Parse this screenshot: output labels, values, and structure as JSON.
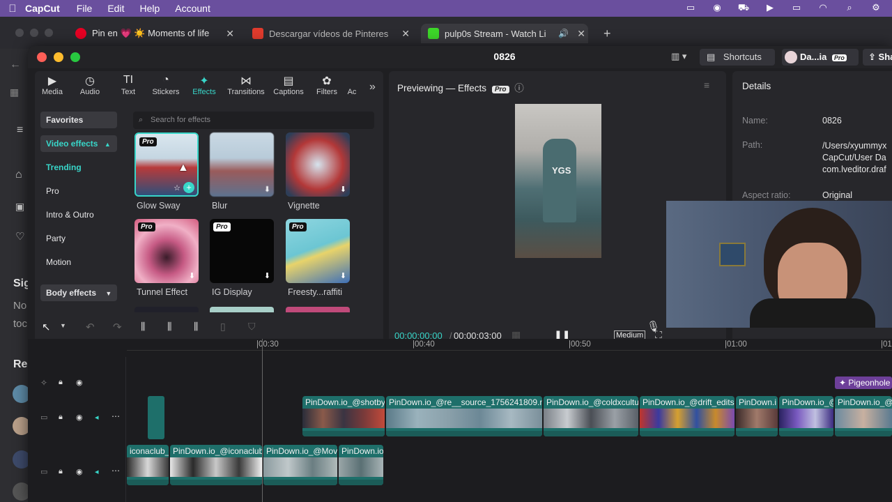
{
  "menubar": {
    "app_name": "CapCut",
    "items": [
      "File",
      "Edit",
      "Help",
      "Account"
    ]
  },
  "browser": {
    "tabs": [
      {
        "title": "Pin en 💗 ☀️ Moments of life",
        "favicon_color": "#e60023"
      },
      {
        "title": "Descargar vídeos de Pinteres",
        "favicon_color": "#e03b2d"
      },
      {
        "title": "pulp0s Stream - Watch Li",
        "favicon_color": "#3dd629"
      }
    ],
    "sidebar_text": [
      "Sig",
      "No",
      "toc",
      "Re"
    ]
  },
  "window": {
    "project_name": "0826",
    "shortcuts_label": "Shortcuts",
    "user_label": "Da...ia",
    "pro_badge": "Pro",
    "share_label": "Sha"
  },
  "tools": [
    {
      "label": "Media",
      "icon": "media-icon",
      "glyph": "▶"
    },
    {
      "label": "Audio",
      "icon": "audio-icon",
      "glyph": "◷"
    },
    {
      "label": "Text",
      "icon": "text-icon",
      "glyph": "TI"
    },
    {
      "label": "Stickers",
      "icon": "stickers-icon",
      "glyph": "◔"
    },
    {
      "label": "Effects",
      "icon": "effects-icon",
      "glyph": "✦"
    },
    {
      "label": "Transitions",
      "icon": "transitions-icon",
      "glyph": "⋈"
    },
    {
      "label": "Captions",
      "icon": "captions-icon",
      "glyph": "▤"
    },
    {
      "label": "Filters",
      "icon": "filters-icon",
      "glyph": "✿"
    },
    {
      "label": "Ac",
      "icon": "adjust-icon",
      "glyph": ""
    }
  ],
  "categories": {
    "favorites": "Favorites",
    "video_effects": "Video effects",
    "trending": "Trending",
    "pro": "Pro",
    "intro_outro": "Intro & Outro",
    "party": "Party",
    "motion": "Motion",
    "body_effects": "Body effects"
  },
  "search": {
    "placeholder": "Search for effects"
  },
  "effects": [
    {
      "name": "Glow Sway",
      "pro": true
    },
    {
      "name": "Blur",
      "pro": false
    },
    {
      "name": "Vignette",
      "pro": false
    },
    {
      "name": "Tunnel Effect",
      "pro": true
    },
    {
      "name": "IG Display",
      "pro": true
    },
    {
      "name": "Freesty...raffiti",
      "pro": true
    }
  ],
  "preview": {
    "title": "Previewing — Effects",
    "pro_badge": "Pro",
    "current_time": "00:00:00:00",
    "total_time": "00:00:03:00",
    "quality": "Medium"
  },
  "details": {
    "title": "Details",
    "name_label": "Name:",
    "name_value": "0826",
    "path_label": "Path:",
    "path_lines": [
      "/Users/xyummyx",
      "CapCut/User Da",
      "com.lveditor.draf"
    ],
    "aspect_label": "Aspect ratio:",
    "aspect_value": "Original"
  },
  "timeline": {
    "ruler": [
      "|00:30",
      "|00:40",
      "|00:50",
      "|01:00",
      "|01"
    ],
    "effect_track_label": "Pigeonhole",
    "track2_clips": [
      "PinDown.io_@shotby",
      "PinDown.io_@re__source_1756241809.m",
      "PinDown.io_@coldxcultu",
      "PinDown.io_@drift_edits",
      "PinDown.i",
      "PinDown.io_@",
      "PinDown.io_@"
    ],
    "track3_clips": [
      "iconaclub_1",
      "PinDown.io_@iconaclub",
      "PinDown.io_@Mov",
      "PinDown.io"
    ]
  },
  "colors": {
    "accent": "#38d6c9",
    "menubar": "#6a4f9e",
    "clip_teal": "#1e6f6a"
  }
}
